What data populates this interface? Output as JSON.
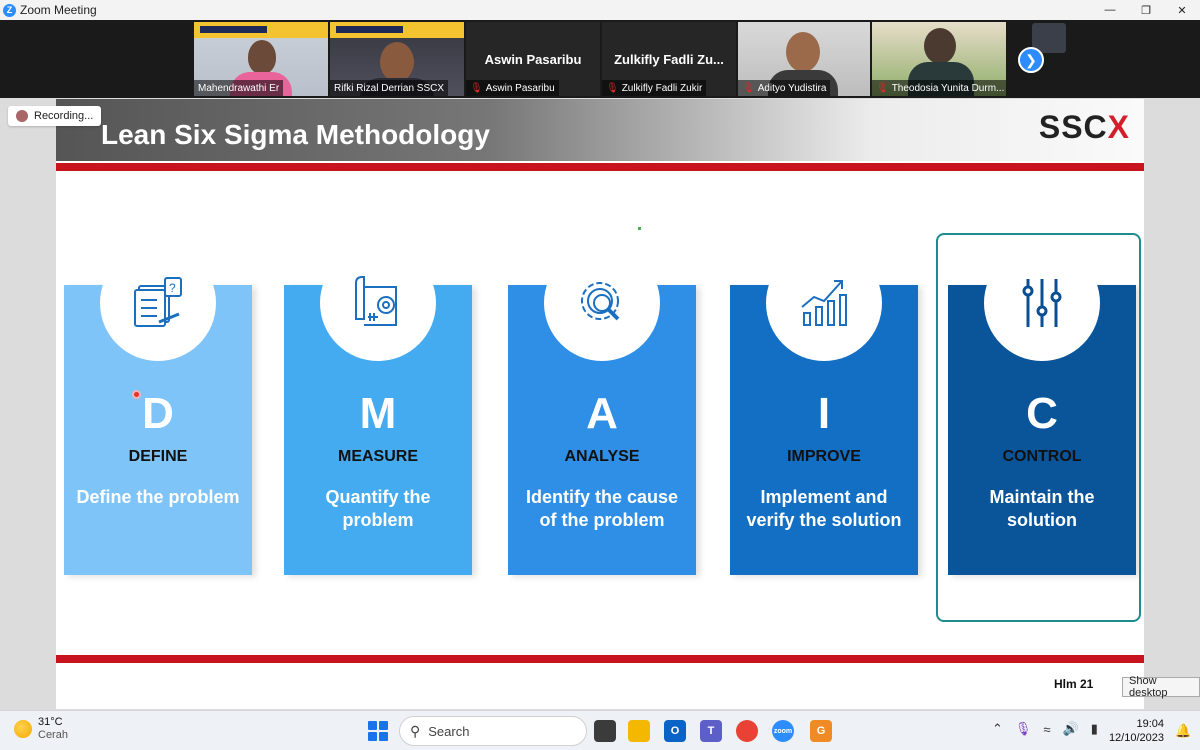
{
  "window": {
    "title": "Zoom Meeting"
  },
  "participants": [
    {
      "name": "Mahendrawathi Er",
      "muted": false,
      "video": true
    },
    {
      "name": "Rifki Rizal Derrian SSCX",
      "muted": false,
      "video": true
    },
    {
      "name": "Aswin Pasaribu",
      "display_name": "Aswin Pasaribu",
      "muted": true,
      "video": false
    },
    {
      "name": "Zulkifly Fadli Zukir",
      "display_name": "Zulkifly Fadli Zu...",
      "muted": true,
      "video": false
    },
    {
      "name": "Adityo Yudistira",
      "muted": true,
      "video": true
    },
    {
      "name": "Theodosia Yunita Durm...",
      "muted": true,
      "video": true
    }
  ],
  "recording": {
    "label": "Recording..."
  },
  "slide": {
    "title": "Lean Six Sigma Methodology",
    "brand": {
      "text": "SSC",
      "accent": "X"
    },
    "page": "Hlm  21",
    "steps": [
      {
        "letter": "D",
        "word": "DEFINE",
        "desc": "Define the problem",
        "color": "#7fc4f8",
        "icon": "questionnaire-icon"
      },
      {
        "letter": "M",
        "word": "MEASURE",
        "desc": "Quantify the problem",
        "color": "#45abf1",
        "icon": "tape-measure-icon"
      },
      {
        "letter": "A",
        "word": "ANALYSE",
        "desc": "Identify the cause of the problem",
        "color": "#2f8fe6",
        "icon": "gear-magnifier-icon"
      },
      {
        "letter": "I",
        "word": "IMPROVE",
        "desc": "Implement and verify the solution",
        "color": "#126fc4",
        "icon": "growth-chart-icon"
      },
      {
        "letter": "C",
        "word": "CONTROL",
        "desc": "Maintain the solution",
        "color": "#0a559a",
        "icon": "sliders-icon"
      }
    ]
  },
  "tooltip": {
    "text": "Show desktop"
  },
  "taskbar": {
    "weather": {
      "temp": "31°C",
      "condition": "Cerah"
    },
    "search_placeholder": "Search",
    "time": "19:04",
    "date": "12/10/2023"
  }
}
